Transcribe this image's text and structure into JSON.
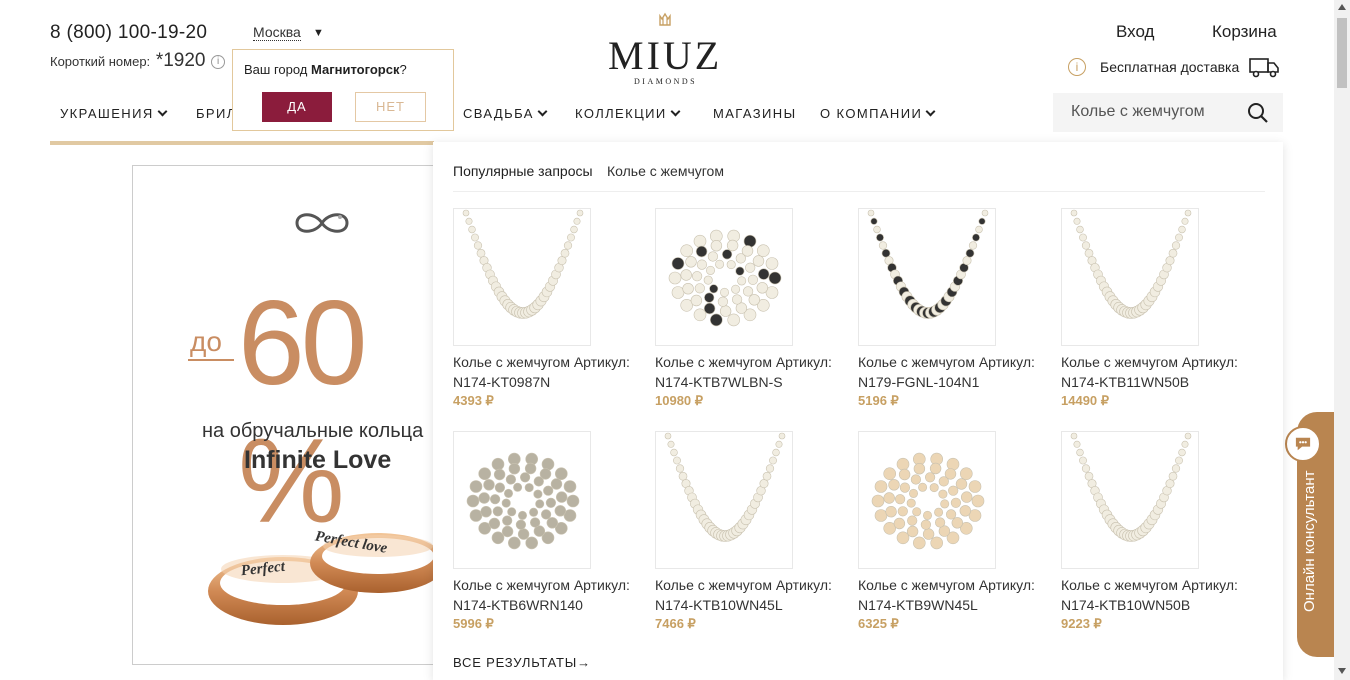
{
  "header": {
    "phone": "8 (800) 100-19-20",
    "short_label": "Короткий номер:",
    "short_number": "*1920",
    "info_glyph": "i",
    "city": "Москва",
    "city_arrow": "▼",
    "login": "Вход",
    "cart": "Корзина",
    "delivery": "Бесплатная доставка",
    "delivery_info_glyph": "i"
  },
  "city_popup": {
    "question_prefix": "Ваш город ",
    "city": "Магнитогорск",
    "question_suffix": "?",
    "yes": "ДА",
    "no": "НЕТ"
  },
  "logo": {
    "name": "MIUZ",
    "sub": "DIAMONDS"
  },
  "nav": {
    "items": [
      {
        "label": "УКРАШЕНИЯ",
        "has_dropdown": true
      },
      {
        "label": "БРИЛ",
        "has_dropdown": false
      },
      {
        "label": "СВАДЬБА",
        "has_dropdown": true
      },
      {
        "label": "КОЛЛЕКЦИИ",
        "has_dropdown": true
      },
      {
        "label": "МАГАЗИНЫ",
        "has_dropdown": false
      },
      {
        "label": "О КОМПАНИИ",
        "has_dropdown": true
      }
    ]
  },
  "search": {
    "value": "Колье с жемчугом",
    "icon": "search-icon"
  },
  "banner": {
    "prefix": "до",
    "big_text": "60 %",
    "subtitle": "на обручальные кольца",
    "title": "Infinite Love",
    "engraving_1": "Perfect",
    "engraving_2": "Perfect love"
  },
  "dropdown": {
    "popular_label": "Популярные запросы",
    "popular_query": "Колье с жемчугом",
    "products": [
      {
        "name": "Колье с жемчугом Артикул: N174-KT0987N",
        "price": "4393 ₽"
      },
      {
        "name": "Колье с жемчугом Артикул: N174-KTB7WLBN-S",
        "price": "10980 ₽"
      },
      {
        "name": "Колье с жемчугом Артикул: N179-FGNL-104N1",
        "price": "5196 ₽"
      },
      {
        "name": "Колье с жемчугом Артикул: N174-KTB11WN50B",
        "price": "14490 ₽"
      },
      {
        "name": "Колье с жемчугом Артикул: N174-KTB6WRN140",
        "price": "5996 ₽"
      },
      {
        "name": "Колье с жемчугом Артикул: N174-KTB10WN45L",
        "price": "7466 ₽"
      },
      {
        "name": "Колье с жемчугом Артикул: N174-KTB9WN45L",
        "price": "6325 ₽"
      },
      {
        "name": "Колье с жемчугом Артикул: N174-KTB10WN50B",
        "price": "9223 ₽"
      }
    ],
    "all_results": "ВСЕ РЕЗУЛЬТАТЫ→"
  },
  "consultant": {
    "label": "Онлайн консультант"
  },
  "colors": {
    "accent_gold": "#c7a063",
    "burgundy": "#8b1c3c",
    "banner_copper": "#c98d62"
  }
}
